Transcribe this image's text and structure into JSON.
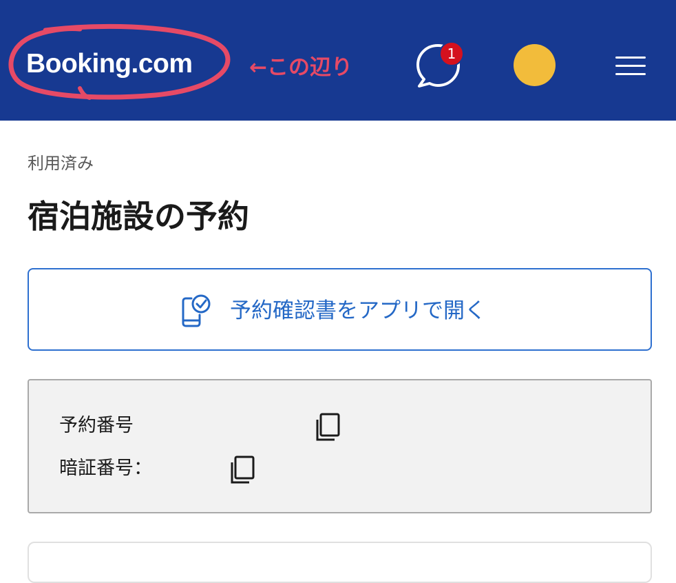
{
  "header": {
    "logo": "Booking.com",
    "annotation": "←この辺り",
    "chat": {
      "badge_count": "1",
      "icon": "chat-bubble-icon"
    },
    "avatar": {
      "color": "#f2bc3b"
    },
    "menu": {
      "icon": "hamburger-menu-icon"
    },
    "background_color": "#173991",
    "annotation_color": "#e64a66"
  },
  "main": {
    "status": "利用済み",
    "title": "宿泊施設の予約",
    "open_app_button": {
      "label": "予約確認書をアプリで開く",
      "icon": "phone-check-icon",
      "accent_color": "#2468c6"
    },
    "reference_panel": {
      "booking_number_label": "予約番号",
      "pin_label": "暗証番号：",
      "copy_icon": "copy-icon"
    }
  }
}
